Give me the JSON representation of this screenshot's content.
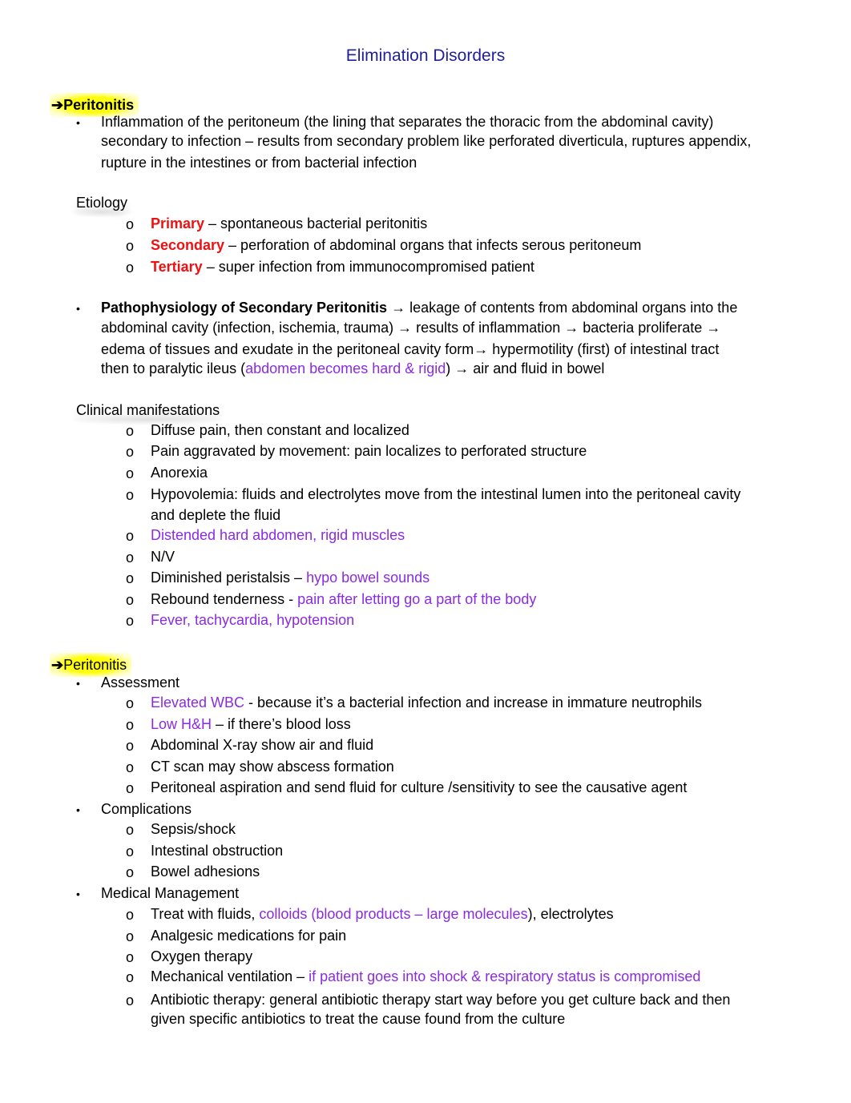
{
  "document": {
    "title": "Elimination Disorders"
  },
  "colors": {
    "title": "#1f1f9a",
    "emphasis_red": "#ee1111",
    "note_purple": "#8a2be2",
    "highlight": "#ffff00"
  },
  "section1": {
    "arrow": "➔",
    "heading": "Peritonitis",
    "definition": {
      "lines": [
        "Inflammation of the peritoneum (the lining that separates the thoracic from the abdominal cavity)",
        "secondary to infection – results from secondary problem like perforated diverticula, ruptures appendix,",
        "rupture in the intestines or from bacterial infection"
      ]
    },
    "etiology": {
      "label": "Etiology",
      "items": [
        {
          "term": "Primary",
          "text": " – spontaneous bacterial peritonitis"
        },
        {
          "term": "Secondary",
          "text": " – perforation of abdominal organs that infects serous peritoneum"
        },
        {
          "term": "Tertiary",
          "text": " – super infection from immunocompromised patient"
        }
      ]
    },
    "pathophysiology": {
      "title": "Pathophysiology of Secondary Peritonitis",
      "arrow": "→",
      "line1_rest": " leakage of contents from abdominal organs into the",
      "line2a": "abdominal cavity (infection, ischemia, trauma) ",
      "line2b": " results of inflammation ",
      "line2c": " bacteria proliferate ",
      "line3a": "edema of tissues and exudate in the peritoneal cavity form",
      "line3b": " hypermotility (first) of intestinal tract",
      "line4a": "then to paralytic ileus (",
      "line4_purple": "abdomen becomes hard & rigid",
      "line4b": ") ",
      "line4c": " air and fluid in bowel"
    },
    "clinical": {
      "label": "Clinical manifestations",
      "items": [
        {
          "text": "Diffuse pain, then constant and localized"
        },
        {
          "text": "Pain aggravated by movement: pain localizes to perforated structure"
        },
        {
          "text": "Anorexia"
        },
        {
          "text": "Hypovolemia: fluids and electrolytes move from the intestinal lumen into the peritoneal cavity",
          "cont": "and deplete the fluid"
        },
        {
          "purple": "Distended hard abdomen, rigid muscles"
        },
        {
          "text": "N/V"
        },
        {
          "text": "Diminished peristalsis – ",
          "purple": "hypo bowel sounds"
        },
        {
          "text": "Rebound tenderness - ",
          "purple": "pain after letting go a part of the body"
        },
        {
          "purple": "Fever, tachycardia, hypotension"
        }
      ]
    }
  },
  "section2": {
    "arrow": "➔",
    "heading": "Peritonitis",
    "assessment": {
      "label": "Assessment",
      "items": [
        {
          "purple": "Elevated WBC",
          "text": " - because it’s a bacterial infection and increase in immature neutrophils"
        },
        {
          "purple": "Low H&H",
          "text": " – if there’s blood loss"
        },
        {
          "text": "Abdominal X-ray show air and fluid"
        },
        {
          "text": "CT scan may show abscess formation"
        },
        {
          "text": "Peritoneal aspiration and send fluid for culture /sensitivity to see the causative agent"
        }
      ]
    },
    "complications": {
      "label": "Complications",
      "items": [
        "Sepsis/shock",
        "Intestinal obstruction",
        "Bowel adhesions"
      ]
    },
    "management": {
      "label": "Medical Management",
      "items": [
        {
          "text": "Treat with fluids, ",
          "purple": "colloids (blood products – large molecules",
          "after": "), electrolytes"
        },
        {
          "text": "Analgesic medications for pain"
        },
        {
          "text": "Oxygen therapy"
        },
        {
          "text": "Mechanical ventilation – ",
          "purple": "if patient goes into shock & respiratory status is compromised"
        },
        {
          "text": "Antibiotic therapy: general antibiotic therapy start way before you get culture back and then",
          "cont": "given specific antibiotics to treat the cause found from the culture"
        }
      ]
    }
  },
  "markers": {
    "bullet": "•",
    "sub_bullet": "o"
  }
}
